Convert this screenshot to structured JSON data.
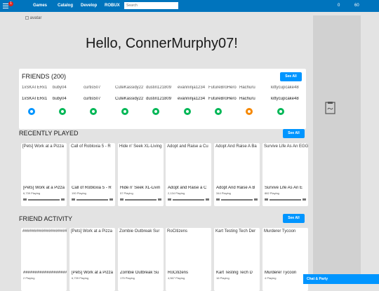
{
  "topbar": {
    "notifications": "1",
    "nav": [
      "Games",
      "Catalog",
      "Develop",
      "ROBUX"
    ],
    "search_placeholder": "Search",
    "robux": "0",
    "friends_count": "60"
  },
  "home": {
    "avatar_alt": "avatar",
    "greeting": "Hello, ConnerMurphy07!"
  },
  "friends": {
    "title": "FRIENDS (200)",
    "see_all": "See All",
    "items": [
      {
        "img": "1xSKATERx1",
        "name": "1xSKATERx1",
        "status": "blue"
      },
      {
        "img": "buby04",
        "name": "buby04",
        "status": "green"
      },
      {
        "img": "curtis507",
        "name": "curtis507",
        "status": "green"
      },
      {
        "img": "CuteKassidy22",
        "name": "CuteKassidy22",
        "status": "green"
      },
      {
        "img": "dustin121809",
        "name": "dustin121809",
        "status": "green"
      },
      {
        "img": "evanninja1234",
        "name": "evanninja1234",
        "status": "green"
      },
      {
        "img": "FutureBroHero",
        "name": "FutureBroHero",
        "status": "green"
      },
      {
        "img": "Hachuru",
        "name": "Hachuru",
        "status": "orange"
      },
      {
        "img": "kittycupcake48",
        "name": "kittycupcake48",
        "status": "green"
      }
    ]
  },
  "recently_played": {
    "title": "RECENTLY PLAYED",
    "see_all": "See All",
    "games": [
      {
        "thumb": "[Pets] Work at a Pizza",
        "title": "[Pets] Work at a Pizza",
        "players": "6,739 Playing"
      },
      {
        "thumb": "Call of Robloxia 5 - R",
        "title": "Call of Robloxia 5 - R",
        "players": "190 Playing"
      },
      {
        "thumb": "Hide n' Seek XL-Living",
        "title": "Hide n' Seek XL-Livin",
        "players": "57 Playing"
      },
      {
        "thumb": "Adopt and Raise a Cu",
        "title": "Adopt and Raise a C",
        "players": "2,134 Playing"
      },
      {
        "thumb": "Adopt And Raise A Ba",
        "title": "Adopt And Raise A B",
        "players": "344 Playing"
      },
      {
        "thumb": "Survive Life As An EGG NI",
        "title": "Survive Life As An E",
        "players": "882 Playing"
      }
    ]
  },
  "friend_activity": {
    "title": "FRIEND ACTIVITY",
    "see_all": "See All",
    "games": [
      {
        "thumb": "###################",
        "title": "###################",
        "players": "2 Playing"
      },
      {
        "thumb": "[Pets] Work at a Pizza",
        "title": "[Pets] Work at a Pizza",
        "players": "6,739 Playing"
      },
      {
        "thumb": "Zombie Outbreak Sur",
        "title": "Zombie Outbreak Su",
        "players": "175 Playing"
      },
      {
        "thumb": "RoCitizens",
        "title": "RoCitizens",
        "players": "4,567 Playing"
      },
      {
        "thumb": "Kart Testing Tech Der",
        "title": "Kart Testing Tech D",
        "players": "16 Playing"
      },
      {
        "thumb": "Murderer Tycoon",
        "title": "Murderer Tycoon",
        "players": "4 Playing"
      }
    ]
  },
  "chat": {
    "label": "Chat & Party"
  }
}
